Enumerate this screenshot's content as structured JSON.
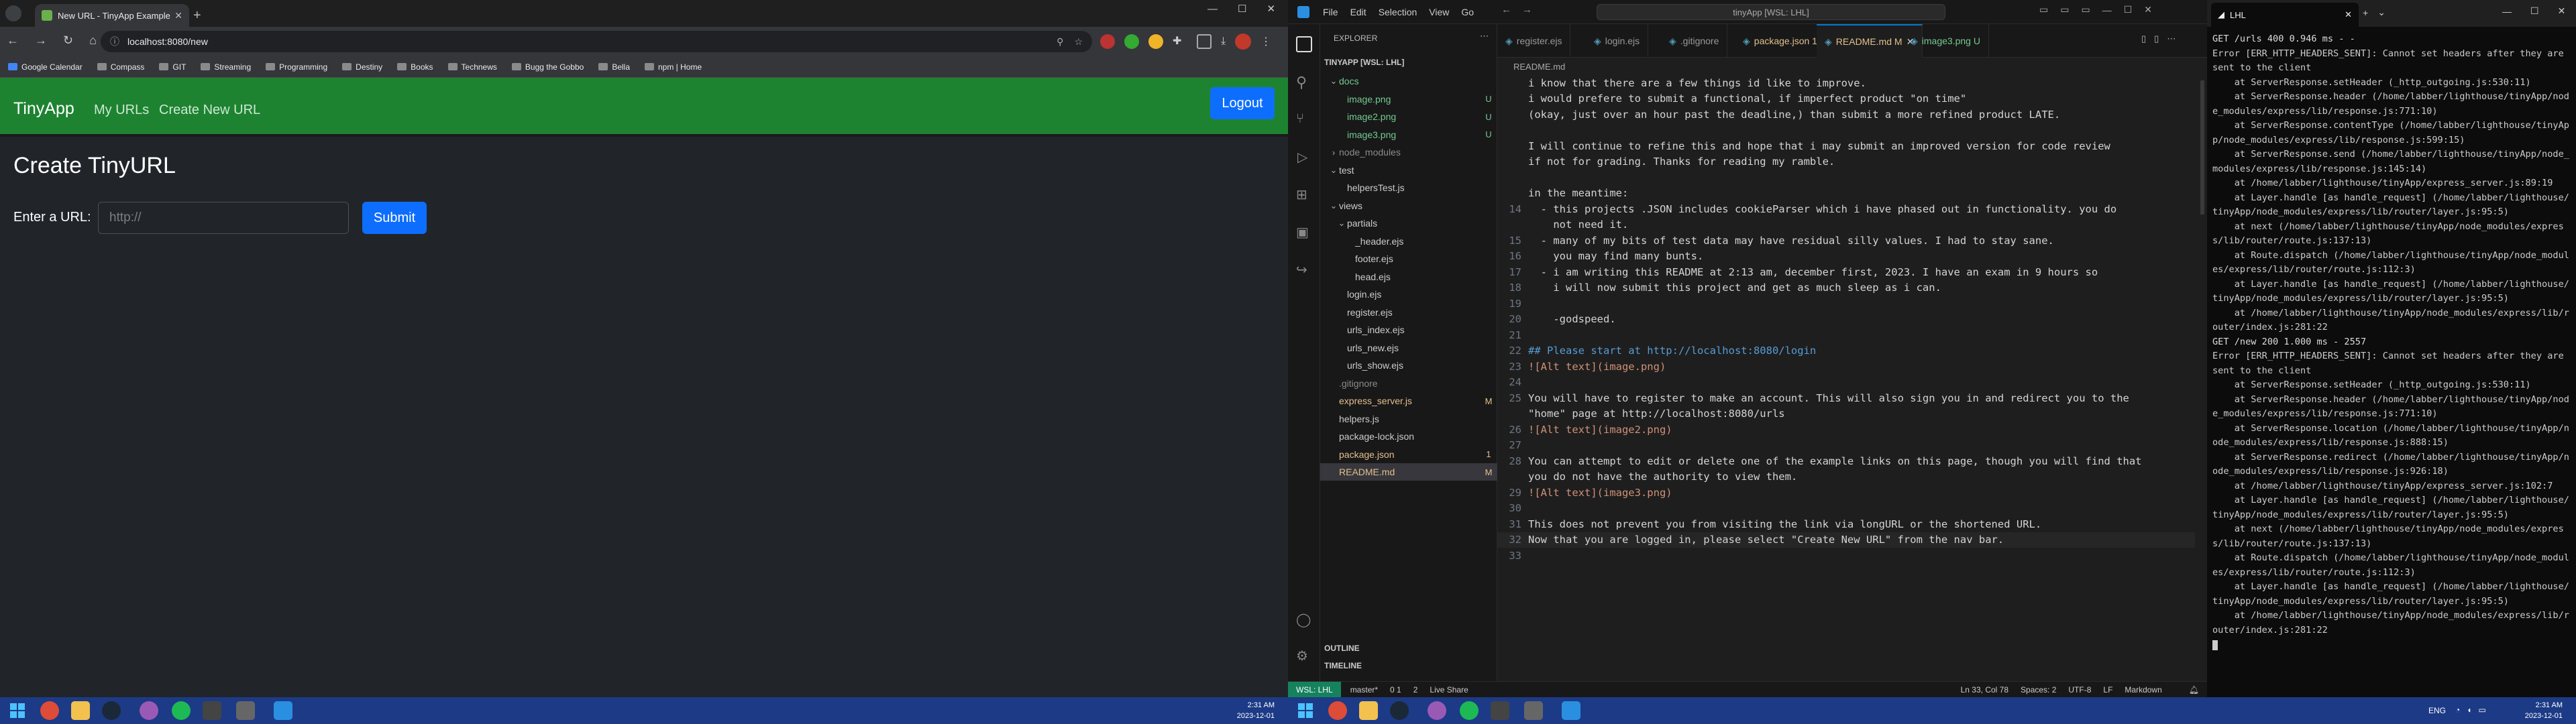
{
  "chrome": {
    "tab_title": "New URL - TinyApp Example",
    "url": "localhost:8080/new",
    "bookmarks": [
      "Google Calendar",
      "Compass",
      "GIT",
      "Streaming",
      "Programming",
      "Destiny",
      "Books",
      "Technews",
      "Bugg the Gobbo",
      "Bella",
      "npm | Home"
    ]
  },
  "site": {
    "brand": "TinyApp",
    "nav_my_urls": "My URLs",
    "nav_create": "Create New URL",
    "logout": "Logout",
    "title": "Create TinyURL",
    "label": "Enter a URL:",
    "placeholder": "http://",
    "submit": "Submit"
  },
  "vscode": {
    "menu": [
      "File",
      "Edit",
      "Selection",
      "View",
      "Go"
    ],
    "search": "tinyApp [WSL: LHL]",
    "explorer_title": "EXPLORER",
    "project": "TINYAPP [WSL: LHL]",
    "tree": [
      {
        "label": "docs",
        "indent": 1,
        "type": "folder",
        "status": "",
        "color": "#73c991"
      },
      {
        "label": "image.png",
        "indent": 2,
        "type": "file",
        "status": "U",
        "color": "#73c991"
      },
      {
        "label": "image2.png",
        "indent": 2,
        "type": "file",
        "status": "U",
        "color": "#73c991"
      },
      {
        "label": "image3.png",
        "indent": 2,
        "type": "file",
        "status": "U",
        "color": "#73c991"
      },
      {
        "label": "node_modules",
        "indent": 1,
        "type": "folder-closed",
        "status": "",
        "color": "#8b8b8b"
      },
      {
        "label": "test",
        "indent": 1,
        "type": "folder",
        "status": "",
        "color": "#cccccc"
      },
      {
        "label": "helpersTest.js",
        "indent": 2,
        "type": "file",
        "status": "",
        "color": "#cccccc"
      },
      {
        "label": "views",
        "indent": 1,
        "type": "folder",
        "status": "",
        "color": "#cccccc"
      },
      {
        "label": "partials",
        "indent": 2,
        "type": "folder",
        "status": "",
        "color": "#cccccc"
      },
      {
        "label": "_header.ejs",
        "indent": 3,
        "type": "file",
        "status": "",
        "color": "#cccccc"
      },
      {
        "label": "footer.ejs",
        "indent": 3,
        "type": "file",
        "status": "",
        "color": "#cccccc"
      },
      {
        "label": "head.ejs",
        "indent": 3,
        "type": "file",
        "status": "",
        "color": "#cccccc"
      },
      {
        "label": "login.ejs",
        "indent": 2,
        "type": "file",
        "status": "",
        "color": "#cccccc"
      },
      {
        "label": "register.ejs",
        "indent": 2,
        "type": "file",
        "status": "",
        "color": "#cccccc"
      },
      {
        "label": "urls_index.ejs",
        "indent": 2,
        "type": "file",
        "status": "",
        "color": "#cccccc"
      },
      {
        "label": "urls_new.ejs",
        "indent": 2,
        "type": "file",
        "status": "",
        "color": "#cccccc"
      },
      {
        "label": "urls_show.ejs",
        "indent": 2,
        "type": "file",
        "status": "",
        "color": "#cccccc"
      },
      {
        "label": ".gitignore",
        "indent": 1,
        "type": "file",
        "status": "",
        "color": "#8b8b8b"
      },
      {
        "label": "express_server.js",
        "indent": 1,
        "type": "file",
        "status": "M",
        "color": "#e2c08d"
      },
      {
        "label": "helpers.js",
        "indent": 1,
        "type": "file",
        "status": "",
        "color": "#cccccc"
      },
      {
        "label": "package-lock.json",
        "indent": 1,
        "type": "file",
        "status": "",
        "color": "#cccccc"
      },
      {
        "label": "package.json",
        "indent": 1,
        "type": "file",
        "status": "1",
        "color": "#e2c08d"
      },
      {
        "label": "README.md",
        "indent": 1,
        "type": "file",
        "status": "M",
        "color": "#e2c08d"
      }
    ],
    "outline": "OUTLINE",
    "timeline": "TIMELINE",
    "tabs": [
      "register.ejs",
      "login.ejs",
      ".gitignore",
      "package.json 1",
      "README.md M",
      "image3.png U"
    ],
    "breadcrumb": "README.md",
    "lines": [
      {
        "n": "",
        "t": "i know that there are a few things id like to improve."
      },
      {
        "n": "",
        "t": "i would prefere to submit a functional, if imperfect product \"on time\""
      },
      {
        "n": "",
        "t": "(okay, just over an hour past the deadline,) than submit a more refined product LATE."
      },
      {
        "n": "",
        "t": ""
      },
      {
        "n": "",
        "t": "I will continue to refine this and hope that i may submit an improved version for code review"
      },
      {
        "n": "",
        "t": "if not for grading. Thanks for reading my ramble."
      },
      {
        "n": "",
        "t": ""
      },
      {
        "n": "",
        "t": "in the meantime:"
      },
      {
        "n": "14",
        "t": "  - this projects .JSON includes cookieParser which i have phased out in functionality. you do"
      },
      {
        "n": "",
        "t": "    not need it."
      },
      {
        "n": "15",
        "t": "  - many of my bits of test data may have residual silly values. I had to stay sane."
      },
      {
        "n": "16",
        "t": "    you may find many bunts."
      },
      {
        "n": "17",
        "t": "  - i am writing this README at 2:13 am, december first, 2023. I have an exam in 9 hours so"
      },
      {
        "n": "18",
        "t": "    i will now submit this project and get as much sleep as i can."
      },
      {
        "n": "19",
        "t": ""
      },
      {
        "n": "20",
        "t": "    -godspeed."
      },
      {
        "n": "21",
        "t": ""
      },
      {
        "n": "22",
        "t": "## Please start at http://localhost:8080/login"
      },
      {
        "n": "23",
        "t": "![Alt text](image.png)"
      },
      {
        "n": "24",
        "t": ""
      },
      {
        "n": "25",
        "t": "You will have to register to make an account. This will also sign you in and redirect you to the"
      },
      {
        "n": "",
        "t": "\"home\" page at http://localhost:8080/urls"
      },
      {
        "n": "26",
        "t": "![Alt text](image2.png)"
      },
      {
        "n": "27",
        "t": ""
      },
      {
        "n": "28",
        "t": "You can attempt to edit or delete one of the example links on this page, though you will find that"
      },
      {
        "n": "",
        "t": "you do not have the authority to view them."
      },
      {
        "n": "29",
        "t": "![Alt text](image3.png)"
      },
      {
        "n": "30",
        "t": ""
      },
      {
        "n": "31",
        "t": "This does not prevent you from visiting the link via longURL or the shortened URL."
      },
      {
        "n": "32",
        "t": "Now that you are logged in, please select \"Create New URL\" from the nav bar."
      },
      {
        "n": "33",
        "t": ""
      }
    ],
    "status_left": "WSL: LHL",
    "status_branch": "master*",
    "status_problems": "0 1",
    "status_ports": "2",
    "status_live": "Live Share",
    "status_right": [
      "Ln 33, Col 78",
      "Spaces: 2",
      "UTF-8",
      "LF",
      "Markdown"
    ]
  },
  "terminal": {
    "tab": "LHL",
    "lines": [
      "GET /urls 400 0.946 ms - -",
      "Error [ERR_HTTP_HEADERS_SENT]: Cannot set headers after they are sent to the client",
      "    at ServerResponse.setHeader (_http_outgoing.js:530:11)",
      "    at ServerResponse.header (/home/labber/lighthouse/tinyApp/node_modules/express/lib/response.js:771:10)",
      "    at ServerResponse.contentType (/home/labber/lighthouse/tinyApp/node_modules/express/lib/response.js:599:15)",
      "    at ServerResponse.send (/home/labber/lighthouse/tinyApp/node_modules/express/lib/response.js:145:14)",
      "    at /home/labber/lighthouse/tinyApp/express_server.js:89:19",
      "    at Layer.handle [as handle_request] (/home/labber/lighthouse/tinyApp/node_modules/express/lib/router/layer.js:95:5)",
      "    at next (/home/labber/lighthouse/tinyApp/node_modules/express/lib/router/route.js:137:13)",
      "    at Route.dispatch (/home/labber/lighthouse/tinyApp/node_modules/express/lib/router/route.js:112:3)",
      "    at Layer.handle [as handle_request] (/home/labber/lighthouse/tinyApp/node_modules/express/lib/router/layer.js:95:5)",
      "    at /home/labber/lighthouse/tinyApp/node_modules/express/lib/router/index.js:281:22",
      "GET /new 200 1.000 ms - 2557",
      "Error [ERR_HTTP_HEADERS_SENT]: Cannot set headers after they are sent to the client",
      "    at ServerResponse.setHeader (_http_outgoing.js:530:11)",
      "    at ServerResponse.header (/home/labber/lighthouse/tinyApp/node_modules/express/lib/response.js:771:10)",
      "    at ServerResponse.location (/home/labber/lighthouse/tinyApp/node_modules/express/lib/response.js:888:15)",
      "    at ServerResponse.redirect (/home/labber/lighthouse/tinyApp/node_modules/express/lib/response.js:926:18)",
      "    at /home/labber/lighthouse/tinyApp/express_server.js:102:7",
      "    at Layer.handle [as handle_request] (/home/labber/lighthouse/tinyApp/node_modules/express/lib/router/layer.js:95:5)",
      "    at next (/home/labber/lighthouse/tinyApp/node_modules/express/lib/router/route.js:137:13)",
      "    at Route.dispatch (/home/labber/lighthouse/tinyApp/node_modules/express/lib/router/route.js:112:3)",
      "    at Layer.handle [as handle_request] (/home/labber/lighthouse/tinyApp/node_modules/express/lib/router/layer.js:95:5)",
      "    at /home/labber/lighthouse/tinyApp/node_modules/express/lib/router/index.js:281:22"
    ]
  },
  "taskbar": {
    "left_time": "2:31 AM",
    "left_date": "2023-12-01",
    "right_time": "2:31 AM",
    "right_date": "2023-12-01",
    "lang": "ENG"
  },
  "colors": {
    "nav_green": "#1d8331",
    "button_blue": "#0d6efd",
    "taskbar": "#1c3a86",
    "term_bg": "#0c0c0c"
  }
}
